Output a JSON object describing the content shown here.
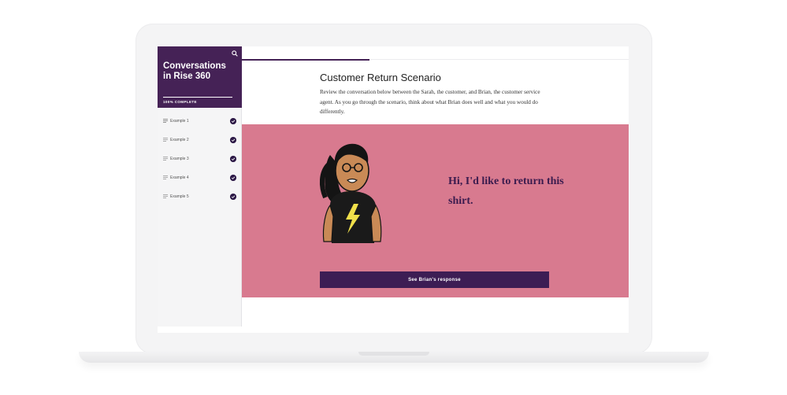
{
  "course": {
    "title": "Conversations in Rise 360",
    "progress_label": "100% COMPLETE",
    "progress_fraction": 1.0
  },
  "lessons": [
    {
      "label": "Example 1",
      "icon": "list-icon",
      "status_icon": "check-icon",
      "active": true
    },
    {
      "label": "Example 2",
      "icon": "list-icon",
      "status_icon": "check-icon",
      "active": false
    },
    {
      "label": "Example 3",
      "icon": "list-icon",
      "status_icon": "check-icon",
      "active": false
    },
    {
      "label": "Example 4",
      "icon": "list-icon",
      "status_icon": "check-icon",
      "active": false
    },
    {
      "label": "Example 5",
      "icon": "list-icon",
      "status_icon": "check-icon",
      "active": false
    }
  ],
  "lesson_progress_fraction": 0.33,
  "main": {
    "title": "Customer Return Scenario",
    "intro": "Review the conversation below between the Sarah, the customer, and Brian, the customer service agent. As you go through the scenario, think about what Brian does well and what you would do differently.",
    "speech": "Hi, I'd like to return this shirt.",
    "button_label": "See Brian's response"
  },
  "colors": {
    "brand_purple": "#452256",
    "panel_pink": "#d87a8f",
    "button_purple": "#3d1d54",
    "speech_text": "#3a1b4e"
  }
}
